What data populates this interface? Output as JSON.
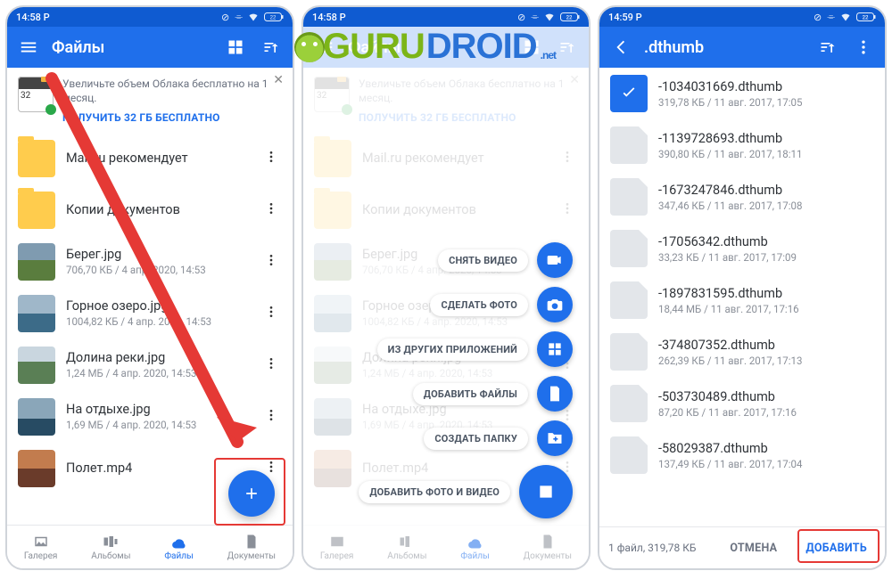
{
  "watermark": {
    "text_g": "GURU",
    "text_u": "DROID",
    "suffix": ".net"
  },
  "statusbar": {
    "time1": "14:58",
    "time2": "14:58",
    "time3": "14:59",
    "carrier": "P",
    "battery": "22"
  },
  "screen1": {
    "title": "Файлы",
    "promo_text": "Увеличьте объем Облака бесплатно на 1 месяц.",
    "promo_cta": "ПОЛУЧИТЬ 32 ГБ БЕСПЛАТНО",
    "items": [
      {
        "name": "Mail.ru рекомендует",
        "sub": "",
        "kind": "folder"
      },
      {
        "name": "Копии документов",
        "sub": "",
        "kind": "folder"
      },
      {
        "name": "Берег.jpg",
        "sub": "706,70 КБ / 4 апр. 2020, 14:53",
        "kind": "photo",
        "cls": "thumb-photo"
      },
      {
        "name": "Горное озеро.jpg",
        "sub": "1004,82 КБ / 4 апр. 2020, 14:53",
        "kind": "photo",
        "cls": "thumb-photo2"
      },
      {
        "name": "Долина реки.jpg",
        "sub": "1,24 МБ / 4 апр. 2020, 14:53",
        "kind": "photo",
        "cls": "thumb-photo3"
      },
      {
        "name": "На отдыхе.jpg",
        "sub": "1,69 МБ / 4 апр. 2020, 14:53",
        "kind": "photo",
        "cls": "thumb-photo4"
      },
      {
        "name": "Полет.mp4",
        "sub": "",
        "kind": "photo",
        "cls": "thumb-photo5"
      }
    ],
    "nav": {
      "gallery": "Галерея",
      "albums": "Альбомы",
      "files": "Файлы",
      "docs": "Документы"
    }
  },
  "screen2": {
    "speed_labels": {
      "video": "СНЯТЬ ВИДЕО",
      "photo": "СДЕЛАТЬ ФОТО",
      "other_apps": "ИЗ ДРУГИХ ПРИЛОЖЕНИЙ",
      "add_files": "ДОБАВИТЬ ФАЙЛЫ",
      "create_folder": "СОЗДАТЬ ПАПКУ",
      "add_media": "ДОБАВИТЬ ФОТО И ВИДЕО"
    }
  },
  "screen3": {
    "title": ".dthumb",
    "items": [
      {
        "name": "-1034031669.dthumb",
        "sub": "319,78 КБ / 11 авг. 2017, 17:05",
        "selected": true
      },
      {
        "name": "-1139728693.dthumb",
        "sub": "390,80 КБ / 11 авг. 2017, 18:11"
      },
      {
        "name": "-1673247846.dthumb",
        "sub": "347,46 КБ / 11 авг. 2017, 17:08"
      },
      {
        "name": "-17056342.dthumb",
        "sub": "33,23 КБ / 11 авг. 2017, 17:09"
      },
      {
        "name": "-1897831595.dthumb",
        "sub": "18,44 МБ / 11 авг. 2017, 17:16"
      },
      {
        "name": "-374807352.dthumb",
        "sub": "262,39 КБ / 11 авг. 2017, 17:13"
      },
      {
        "name": "-503730489.dthumb",
        "sub": "87,20 КБ / 11 авг. 2017, 17:16"
      },
      {
        "name": "-58029387.dthumb",
        "sub": "137,49 КБ / 11 авг. 2017, 17:04"
      }
    ],
    "footer_summary": "1 файл, 319,78 КБ",
    "cancel": "ОТМЕНА",
    "add": "ДОБАВИТЬ"
  }
}
